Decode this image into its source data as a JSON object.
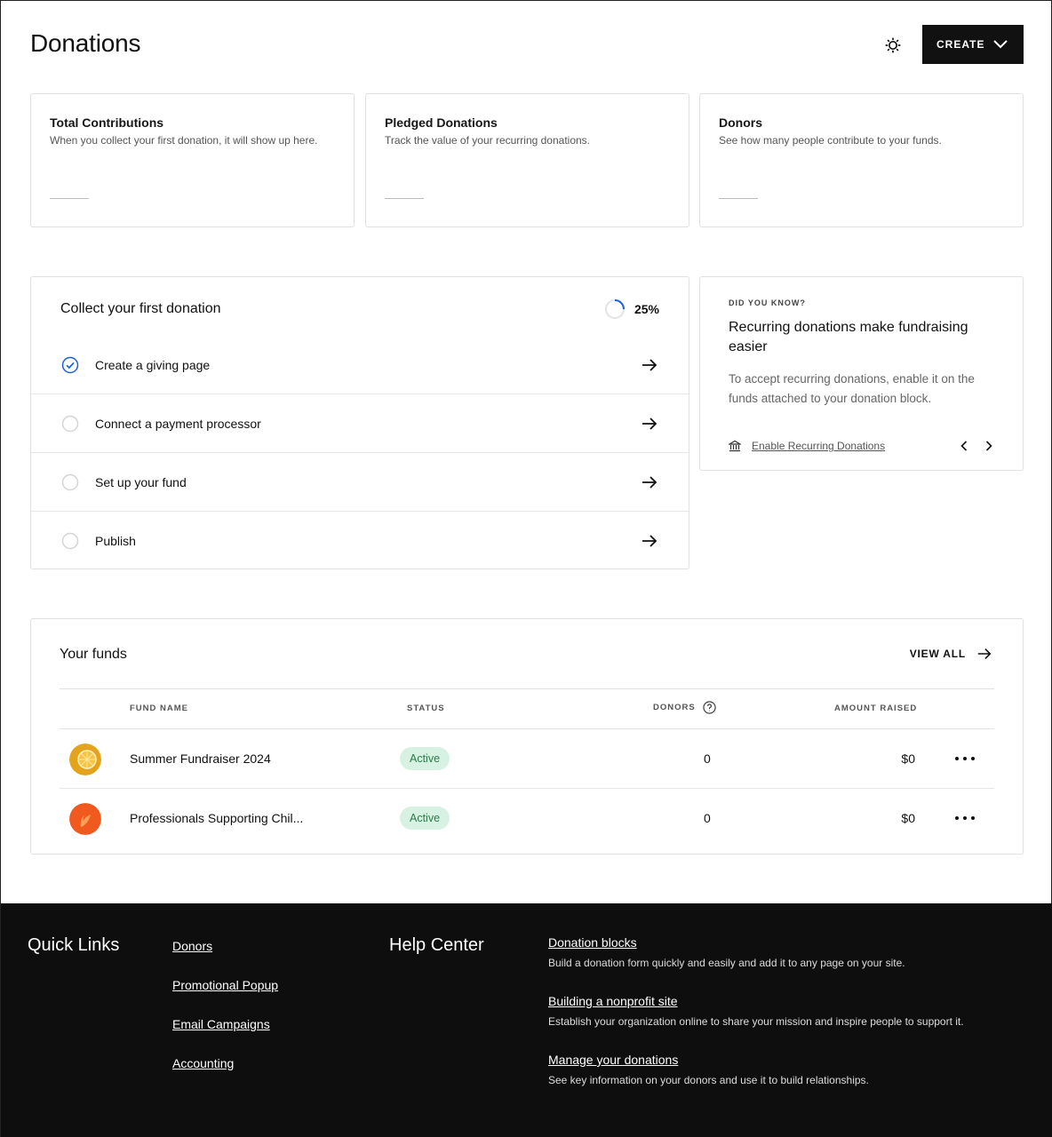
{
  "header": {
    "title": "Donations",
    "create_label": "CREATE"
  },
  "stats": [
    {
      "title": "Total Contributions",
      "description": "When you collect your first donation, it will show up here."
    },
    {
      "title": "Pledged Donations",
      "description": "Track the value of your recurring donations."
    },
    {
      "title": "Donors",
      "description": "See how many people contribute to your funds."
    }
  ],
  "checklist": {
    "title": "Collect your first donation",
    "progress": 0.25,
    "progress_label": "25%",
    "steps": [
      {
        "label": "Create a giving page",
        "done": true
      },
      {
        "label": "Connect a payment processor",
        "done": false
      },
      {
        "label": "Set up your fund",
        "done": false
      },
      {
        "label": "Publish",
        "done": false
      }
    ]
  },
  "did_you_know": {
    "eyebrow": "DID YOU KNOW?",
    "title": "Recurring donations make fundraising easier",
    "body": "To accept recurring donations, enable it on the funds attached to your donation block.",
    "link": "Enable Recurring Donations"
  },
  "funds": {
    "title": "Your funds",
    "view_all": "VIEW ALL",
    "columns": {
      "name": "FUND NAME",
      "status": "STATUS",
      "donors": "DONORS",
      "amount": "AMOUNT RAISED"
    },
    "rows": [
      {
        "name": "Summer Fundraiser 2024",
        "status": "Active",
        "donors": "0",
        "amount": "$0"
      },
      {
        "name": "Professionals Supporting Chil...",
        "status": "Active",
        "donors": "0",
        "amount": "$0"
      }
    ]
  },
  "footer": {
    "quick_links_title": "Quick Links",
    "quick_links": [
      "Donors",
      "Promotional Popup",
      "Email Campaigns",
      "Accounting"
    ],
    "help_center_title": "Help Center",
    "help_items": [
      {
        "title": "Donation blocks",
        "description": "Build a donation form quickly and easily and add it to any page on your site."
      },
      {
        "title": "Building a nonprofit site",
        "description": "Establish your organization online to share your mission and inspire people to support it."
      },
      {
        "title": "Manage your donations",
        "description": "See key information on your donors and use it to build relationships."
      }
    ]
  },
  "colors": {
    "accent": "#1d63d6",
    "status_bg": "#d7f2e2",
    "status_text": "#2c7a4b",
    "footer_bg": "#0e0e0e"
  }
}
